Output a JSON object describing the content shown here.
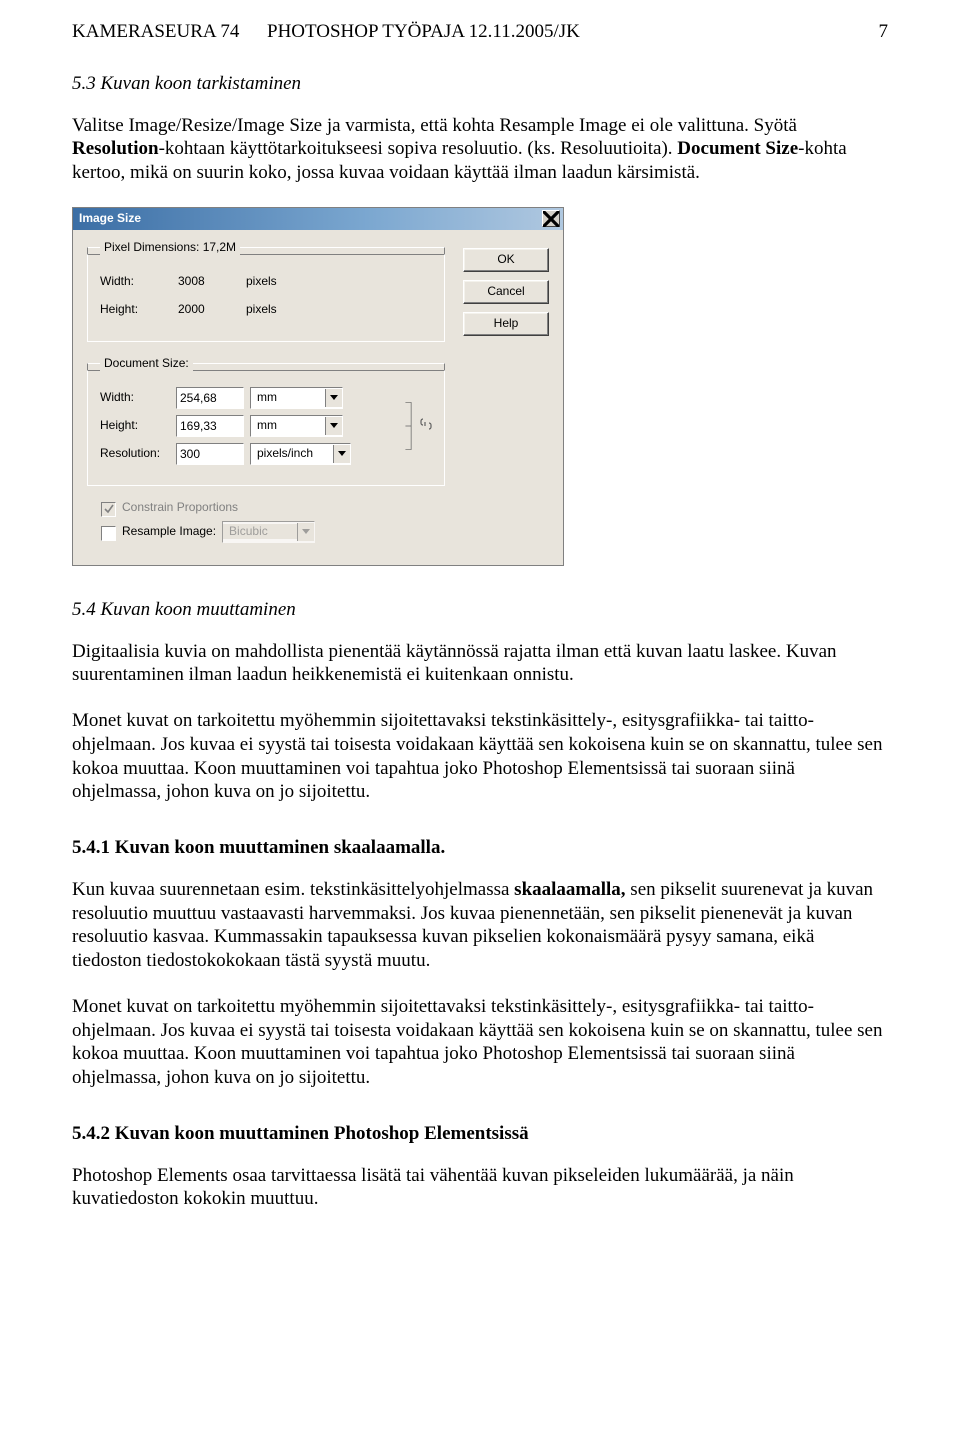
{
  "header": {
    "left": "KAMERASEURA 74",
    "center": "PHOTOSHOP TYÖPAJA 12.11.2005/JK",
    "page_num": "7"
  },
  "section_53": {
    "title": "5.3 Kuvan koon tarkistaminen",
    "p1_a": "Valitse Image/Resize/Image Size ja varmista, että kohta Resample Image ei ole valittuna. Syötä ",
    "p1_b": "Resolution",
    "p1_c": "-kohtaan käyttötarkoitukseesi sopiva resoluutio. (ks. Resoluutioita). ",
    "p1_d": "Document Size",
    "p1_e": "-kohta kertoo, mikä on suurin koko, jossa kuvaa voidaan käyttää ilman laadun kärsimistä."
  },
  "dialog": {
    "title": "Image Size",
    "buttons": {
      "ok": "OK",
      "cancel": "Cancel",
      "help": "Help"
    },
    "pixel_dimensions_label": "Pixel Dimensions: 17,2M",
    "width_label": "Width:",
    "height_label": "Height:",
    "resolution_label": "Resolution:",
    "px_width": "3008",
    "px_height": "2000",
    "pixels_unit": "pixels",
    "doc_size_label": "Document Size:",
    "doc_width": "254,68",
    "doc_height": "169,33",
    "doc_unit": "mm",
    "resolution_value": "300",
    "resolution_unit": "pixels/inch",
    "constrain_label": "Constrain Proportions",
    "resample_label": "Resample Image:",
    "resample_method": "Bicubic"
  },
  "section_54": {
    "title": "5.4 Kuvan koon muuttaminen",
    "p1": "Digitaalisia kuvia on mahdollista pienentää käytännössä rajatta ilman että kuvan laatu laskee. Kuvan suurentaminen ilman laadun heikkenemistä ei kuitenkaan onnistu.",
    "p2": "Monet kuvat on tarkoitettu myöhemmin sijoitettavaksi tekstinkäsittely-, esitysgrafiikka- tai taitto-ohjelmaan. Jos kuvaa ei syystä tai toisesta voidakaan käyttää sen kokoisena kuin se on skannattu, tulee sen kokoa muuttaa. Koon muuttaminen voi tapahtua joko Photoshop Elementsissä tai suoraan siinä ohjelmassa, johon kuva on jo sijoitettu."
  },
  "section_541": {
    "title": "5.4.1 Kuvan koon muuttaminen skaalaamalla.",
    "p1_a": "Kun kuvaa suurennetaan esim. tekstinkäsittelyohjelmassa ",
    "p1_b": "skaalaamalla,",
    "p1_c": " sen pikselit suurenevat ja kuvan resoluutio muuttuu vastaavasti harvemmaksi. Jos kuvaa pienennetään, sen pikselit pienenevät ja kuvan resoluutio kasvaa. Kummassakin tapauksessa kuvan pikselien kokonaismäärä pysyy samana, eikä tiedoston tiedostokokokaan tästä syystä muutu.",
    "p2": "Monet kuvat on tarkoitettu myöhemmin sijoitettavaksi tekstinkäsittely-, esitysgrafiikka- tai taitto-ohjelmaan. Jos kuvaa ei syystä tai toisesta voidakaan käyttää sen kokoisena kuin se on skannattu, tulee sen kokoa muuttaa. Koon muuttaminen voi tapahtua joko Photoshop Elementsissä tai suoraan siinä ohjelmassa, johon kuva on jo sijoitettu."
  },
  "section_542": {
    "title": "5.4.2 Kuvan koon muuttaminen Photoshop Elementsissä",
    "p1": "Photoshop Elements osaa tarvittaessa lisätä tai vähentää kuvan pikseleiden lukumäärää, ja näin kuvatiedoston kokokin muuttuu."
  }
}
